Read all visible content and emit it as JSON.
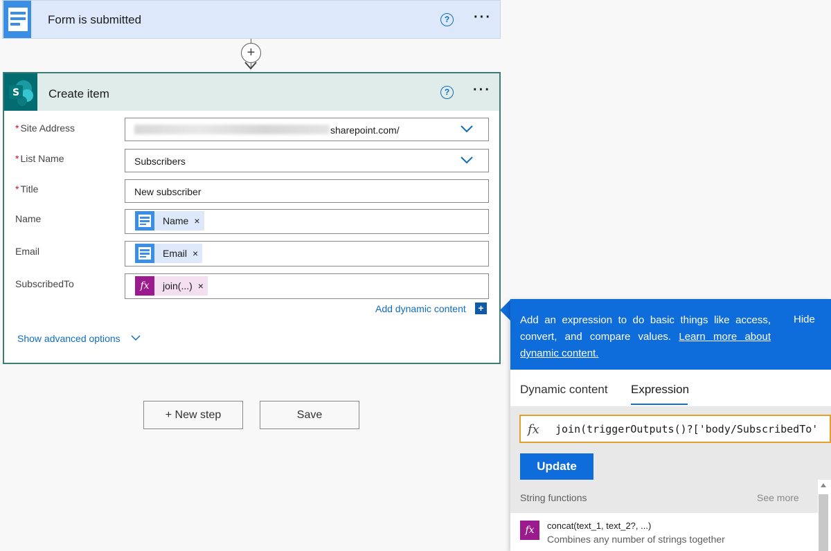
{
  "trigger": {
    "title": "Form is submitted",
    "help": "?",
    "more": "···"
  },
  "connector": {
    "add": "+"
  },
  "action": {
    "title": "Create item",
    "help": "?",
    "more": "···",
    "fields": {
      "site_address": {
        "label": "Site Address",
        "required": "*",
        "value_suffix": "sharepoint.com/"
      },
      "list_name": {
        "label": "List Name",
        "required": "*",
        "value": "Subscribers"
      },
      "title": {
        "label": "Title",
        "required": "*",
        "value": "New subscriber"
      },
      "name": {
        "label": "Name",
        "token": "Name",
        "remove": "×"
      },
      "email": {
        "label": "Email",
        "token": "Email",
        "remove": "×"
      },
      "subscribed_to": {
        "label": "SubscribedTo",
        "token": "join(...)",
        "token_icon": "fx",
        "remove": "×"
      }
    },
    "add_dynamic_content": "Add dynamic content",
    "add_dynamic_icon": "+",
    "show_advanced": "Show advanced options"
  },
  "buttons": {
    "new_step": "+ New step",
    "save": "Save"
  },
  "panel": {
    "description": "Add an expression to do basic things like access, convert, and compare values.",
    "learn_more": "Learn more about dynamic content.",
    "hide": "Hide",
    "tabs": [
      "Dynamic content",
      "Expression"
    ],
    "active_tab": "Expression",
    "expression_icon": "fx",
    "expression": "join(triggerOutputs()?['body/SubscribedTo'",
    "update": "Update",
    "section_title": "String functions",
    "see_more": "See more",
    "functions": [
      {
        "icon": "fx",
        "name": "concat(text_1, text_2?, ...)",
        "desc": "Combines any number of strings together"
      }
    ]
  },
  "colors": {
    "accent": "#0f6cdb",
    "trigger_bg": "#dde9fa",
    "action_border": "#3a7d74",
    "expression_token": "#9b1b8f"
  }
}
